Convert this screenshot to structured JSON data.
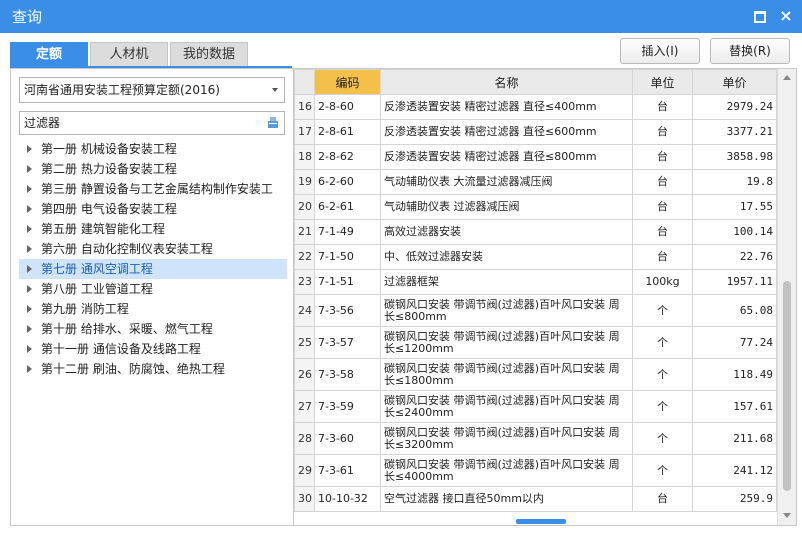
{
  "window": {
    "title": "查询",
    "maximize_label": "maximize-icon",
    "close_label": "×"
  },
  "tabs": [
    {
      "label": "定额",
      "active": true
    },
    {
      "label": "人材机",
      "active": false
    },
    {
      "label": "我的数据",
      "active": false
    }
  ],
  "buttons": {
    "insert": "插入(I)",
    "replace": "替换(R)"
  },
  "library": {
    "selected": "河南省通用安装工程预算定额(2016)"
  },
  "search": {
    "value": "过滤器"
  },
  "tree": [
    {
      "label": "第一册  机械设备安装工程",
      "selected": false
    },
    {
      "label": "第二册  热力设备安装工程",
      "selected": false
    },
    {
      "label": "第三册  静置设备与工艺金属结构制作安装工",
      "selected": false
    },
    {
      "label": "第四册  电气设备安装工程",
      "selected": false
    },
    {
      "label": "第五册  建筑智能化工程",
      "selected": false
    },
    {
      "label": "第六册  自动化控制仪表安装工程",
      "selected": false
    },
    {
      "label": "第七册  通风空调工程",
      "selected": true
    },
    {
      "label": "第八册  工业管道工程",
      "selected": false
    },
    {
      "label": "第九册  消防工程",
      "selected": false
    },
    {
      "label": "第十册  给排水、采暖、燃气工程",
      "selected": false
    },
    {
      "label": "第十一册  通信设备及线路工程",
      "selected": false
    },
    {
      "label": "第十二册  刷油、防腐蚀、绝热工程",
      "selected": false
    }
  ],
  "table": {
    "headers": {
      "code": "编码",
      "name": "名称",
      "unit": "单位",
      "price": "单价"
    },
    "rows": [
      {
        "n": "16",
        "code": "2-8-60",
        "name": "反渗透装置安装  精密过滤器  直径≤400mm",
        "unit": "台",
        "price": "2979.24",
        "tall": false
      },
      {
        "n": "17",
        "code": "2-8-61",
        "name": "反渗透装置安装  精密过滤器  直径≤600mm",
        "unit": "台",
        "price": "3377.21",
        "tall": false
      },
      {
        "n": "18",
        "code": "2-8-62",
        "name": "反渗透装置安装  精密过滤器  直径≤800mm",
        "unit": "台",
        "price": "3858.98",
        "tall": false
      },
      {
        "n": "19",
        "code": "6-2-60",
        "name": "气动辅助仪表  大流量过滤器减压阀",
        "unit": "台",
        "price": "19.8",
        "tall": false
      },
      {
        "n": "20",
        "code": "6-2-61",
        "name": "气动辅助仪表  过滤器减压阀",
        "unit": "台",
        "price": "17.55",
        "tall": false
      },
      {
        "n": "21",
        "code": "7-1-49",
        "name": "高效过滤器安装",
        "unit": "台",
        "price": "100.14",
        "tall": false
      },
      {
        "n": "22",
        "code": "7-1-50",
        "name": "中、低效过滤器安装",
        "unit": "台",
        "price": "22.76",
        "tall": false
      },
      {
        "n": "23",
        "code": "7-1-51",
        "name": "过滤器框架",
        "unit": "100kg",
        "price": "1957.11",
        "tall": false
      },
      {
        "n": "24",
        "code": "7-3-56",
        "name": "碳钢风口安装  带调节阀(过滤器)百叶风口安装  周长≤800mm",
        "unit": "个",
        "price": "65.08",
        "tall": true
      },
      {
        "n": "25",
        "code": "7-3-57",
        "name": "碳钢风口安装  带调节阀(过滤器)百叶风口安装  周长≤1200mm",
        "unit": "个",
        "price": "77.24",
        "tall": true
      },
      {
        "n": "26",
        "code": "7-3-58",
        "name": "碳钢风口安装  带调节阀(过滤器)百叶风口安装  周长≤1800mm",
        "unit": "个",
        "price": "118.49",
        "tall": true
      },
      {
        "n": "27",
        "code": "7-3-59",
        "name": "碳钢风口安装  带调节阀(过滤器)百叶风口安装  周长≤2400mm",
        "unit": "个",
        "price": "157.61",
        "tall": true
      },
      {
        "n": "28",
        "code": "7-3-60",
        "name": "碳钢风口安装  带调节阀(过滤器)百叶风口安装  周长≤3200mm",
        "unit": "个",
        "price": "211.68",
        "tall": true
      },
      {
        "n": "29",
        "code": "7-3-61",
        "name": "碳钢风口安装  带调节阀(过滤器)百叶风口安装  周长≤4000mm",
        "unit": "个",
        "price": "241.12",
        "tall": true
      },
      {
        "n": "30",
        "code": "10-10-32",
        "name": "空气过滤器  接口直径50mm以内",
        "unit": "台",
        "price": "259.9",
        "tall": false
      }
    ]
  },
  "colors": {
    "accent": "#3a8ee6",
    "code_header": "#f5c04a",
    "selected_row": "#cfe4fa"
  }
}
